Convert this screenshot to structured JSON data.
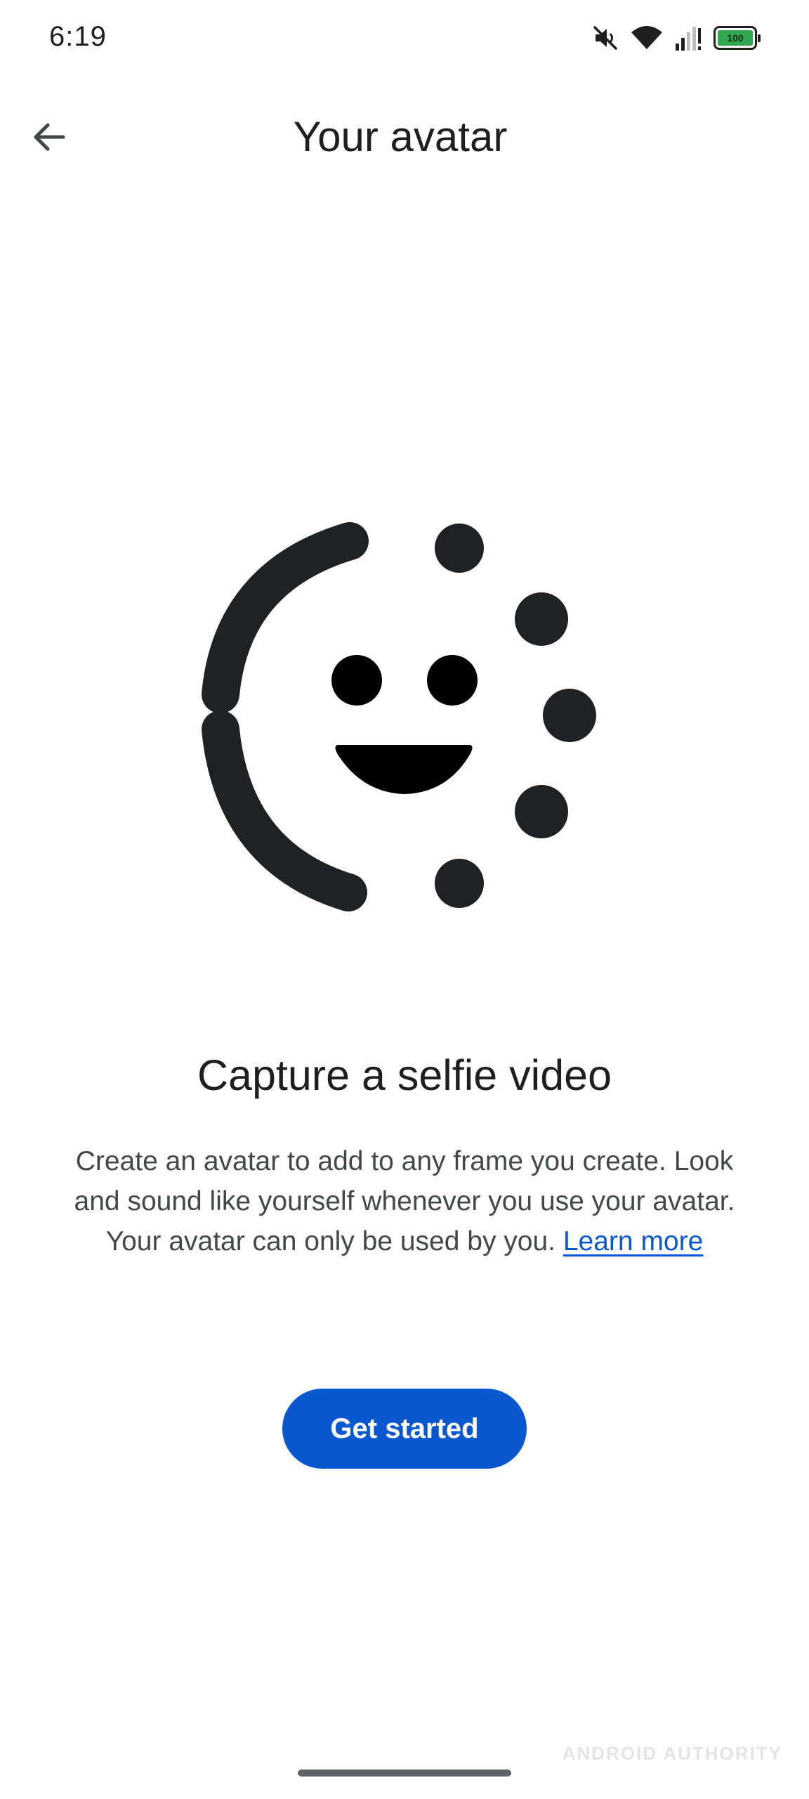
{
  "status_bar": {
    "time": "6:19",
    "battery_level": "100",
    "icons": [
      "mute-icon",
      "wifi-icon",
      "signal-icon",
      "battery-icon"
    ]
  },
  "app_bar": {
    "title": "Your avatar",
    "back_icon": "arrow-back-icon"
  },
  "illustration": {
    "icon": "smiling-face-with-loading-ring-icon",
    "color": "#202124"
  },
  "content": {
    "headline": "Capture a selfie video",
    "body": "Create an avatar to add to any frame you create. Look and sound like yourself whenever you use your avatar. Your avatar can only be used by you.",
    "learn_more": "Learn more",
    "link_color": "#0b57d0"
  },
  "primary_action": {
    "label": "Get started",
    "color": "#0b57d0"
  },
  "watermark": "ANDROID AUTHORITY"
}
